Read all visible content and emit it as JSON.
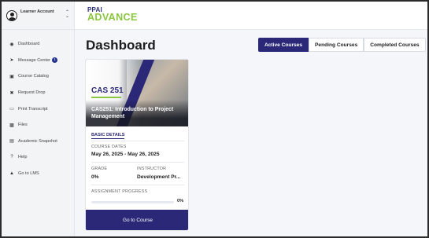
{
  "account": {
    "label": "Learner Account",
    "chevron_icon": "chevron-up-down-icon",
    "avatar_icon": "user-icon"
  },
  "brand": {
    "line1": "PPAI",
    "line2": "ADVANCE",
    "colors": {
      "primary": "#2b2878",
      "accent": "#8ac73f"
    }
  },
  "sidebar": {
    "items": [
      {
        "label": "Dashboard",
        "icon": "gauge-icon"
      },
      {
        "label": "Message Center",
        "icon": "paper-plane-icon",
        "badge": "1"
      },
      {
        "label": "Course Catalog",
        "icon": "cart-icon"
      },
      {
        "label": "Request Drop",
        "icon": "x-icon"
      },
      {
        "label": "Print Transcript",
        "icon": "document-icon"
      },
      {
        "label": "Files",
        "icon": "file-icon"
      },
      {
        "label": "Academic Snapshot",
        "icon": "bar-chart-icon"
      },
      {
        "label": "Help",
        "icon": "question-icon"
      },
      {
        "label": "Go to LMS",
        "icon": "graduation-cap-icon"
      }
    ]
  },
  "main": {
    "title": "Dashboard",
    "tabs": [
      {
        "label": "Active Courses",
        "active": true
      },
      {
        "label": "Pending Courses",
        "active": false
      },
      {
        "label": "Completed Courses",
        "active": false
      }
    ]
  },
  "course": {
    "code": "CAS 251",
    "title": "CAS251: Introduction to Project Management",
    "section_title": "BASIC DETAILS",
    "dates_label": "COURSE DATES",
    "dates_value": "May 26, 2025 - May 26, 2025",
    "grade_label": "GRADE",
    "grade_value": "0%",
    "instructor_label": "INSTRUCTOR",
    "instructor_value": "Development Pr...",
    "progress_label": "ASSIGNMENT PROGRESS",
    "progress_text": "0%",
    "progress_fraction": 0,
    "cta_label": "Go to Course"
  }
}
